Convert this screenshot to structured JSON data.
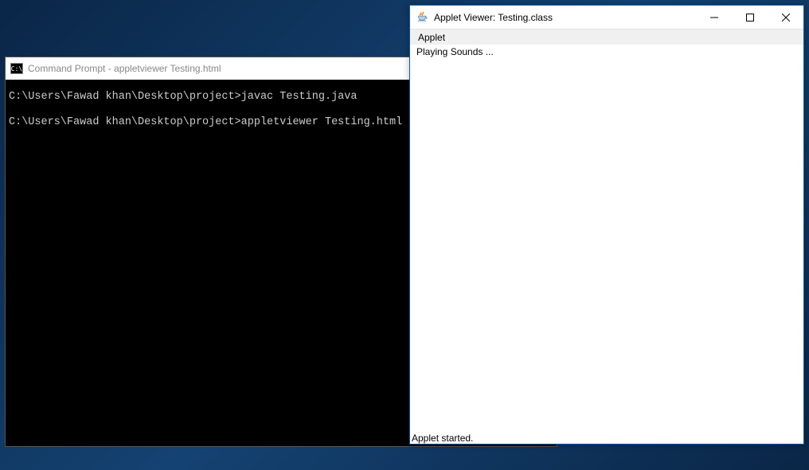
{
  "cmd": {
    "title": "Command Prompt - appletviewer  Testing.html",
    "lines": [
      "C:\\Users\\Fawad khan\\Desktop\\project>javac Testing.java",
      "C:\\Users\\Fawad khan\\Desktop\\project>appletviewer Testing.html"
    ]
  },
  "applet": {
    "title": "Applet Viewer: Testing.class",
    "menu": {
      "applet": "Applet"
    },
    "content": "Playing Sounds ...",
    "status": "Applet started."
  }
}
